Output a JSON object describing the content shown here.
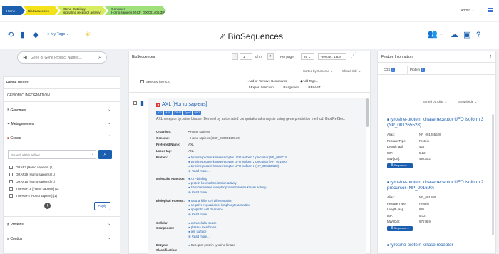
{
  "breadcrumb": {
    "home": "Home",
    "biosequences": "BioSequences",
    "gene_ontology_1": "Gene Ontology",
    "gene_ontology_2": "signaling receptor activity",
    "genomes_1": "Genomes",
    "genomes_2": "Homo sapiens (GCF_000001405.39)"
  },
  "header": {
    "admin": "Admin ⌄",
    "brand": "BioSequences",
    "my_tags": "My Tags ⌄"
  },
  "search": {
    "placeholder": "Gene or Gene Product Names..."
  },
  "refine": {
    "title": "Refine results",
    "genomic_info": "GENOMIC INFORMATION",
    "genomes": "Genomes",
    "metagenomes": "Metagenomes",
    "genes": "Genes",
    "within_placeholder": "Search within refiner",
    "proteins": "Proteins",
    "contigs": "Contigs",
    "apply": "Apply",
    "gene_items": [
      "ORAF3 [Homo sapiens] (1)",
      "ORAF29 [Homo sapiens] (1)",
      "ORAF16 [Homo sapiens] (1)",
      "TNFRSF18 [Homo sapiens] (1)",
      "TNFRSF4 [Homo sapiens] (1)"
    ]
  },
  "results": {
    "title": "BioSequences",
    "page": "1",
    "of": "of 74",
    "per_page_label": "Per page:",
    "per_page": "25",
    "count": "Results: 1,834",
    "sorted": "Sorted by Genome ⌄",
    "showhide": "Show/Hide ⌄",
    "selected": "Selected items: 0",
    "add_remove": "Add or Remove Bookmarks",
    "add_tags": "Add Tags...",
    "export": "Export Selection ⌄",
    "alignment": "Alignment ⌄",
    "blast": "BLAST ⌄"
  },
  "record": {
    "title": "AXL [Homo sapiens]",
    "badges": [
      "AXL",
      "AXL",
      "JOB11",
      "Tyro7",
      "UFO"
    ],
    "desc": "AXL receptor tyrosine kinase; Derived by automated computational analysis using gene prediction method: BestRefSeq.",
    "organism_label": "Organism:",
    "organism": "Homo sapiens",
    "genome_label": "Genome:",
    "genome": "Homo sapiens (GCF_000001405.39)",
    "pref_label": "Preferred Name:",
    "pref": "AXL",
    "locus_label": "Locus tag:",
    "locus": "AXL",
    "protein_label": "Protein:",
    "proteins": [
      "tyrosine-protein kinase receptor UFO isoform 1 precursor (NP_068713)",
      "tyrosine-protein kinase receptor UFO isoform 2 precursor (NP_001690)",
      "tyrosine-protein kinase receptor UFO isoform 3 (NP_001265528)"
    ],
    "read_more": "Read more...",
    "molfn_label": "Molecular Function:",
    "molfn": [
      "ATP binding",
      "protein heterodimerization activity",
      "transmembrane receptor protein tyrosine kinase activity"
    ],
    "bioproc_label": "Biological Process:",
    "bioproc": [
      "natural killer cell differentiation",
      "negative regulation of lymphocyte activation",
      "apoptotic cell clearance"
    ],
    "cell_label_1": "Cellular",
    "cell_label_2": "Component:",
    "cell": [
      "extracellular space",
      "plasma membrane",
      "cell surface"
    ],
    "enzyme_label_1": "Enzyme",
    "enzyme_label_2": "Classification:",
    "enzyme": "Receptor protein-tyrosine kinase"
  },
  "feature": {
    "title": "Feature Information",
    "tab_cds": "CDS",
    "cds_count": "3",
    "tab_protein": "Protein",
    "protein_count": "3",
    "sorted": "Sorted by Alias ⌄",
    "showhide": "Show/Hide ⌄",
    "sequence_btn": "Sequence...",
    "cards": [
      {
        "title": "tyrosine-protein kinase receptor UFO isoform 3 (NP_001265528)",
        "alias": "NP_001265528",
        "type": "Protein",
        "length": "426",
        "iep": "5.22",
        "mw": "49230.2"
      },
      {
        "title": "tyrosine-protein kinase receptor UFO isoform 2 precursor (NP_001690)",
        "alias": "NP_001690",
        "type": "Protein",
        "length": "885",
        "iep": "5.02",
        "mw": "97576.9"
      },
      {
        "title": "tyrosine-protein kinase receptor",
        "alias": "",
        "type": "",
        "length": "",
        "iep": "",
        "mw": ""
      }
    ],
    "labels": {
      "alias": "Alias:",
      "type": "Feature Type:",
      "length": "Length [aa]:",
      "iep": "IEP:",
      "mw": "MW [Da]:"
    }
  }
}
